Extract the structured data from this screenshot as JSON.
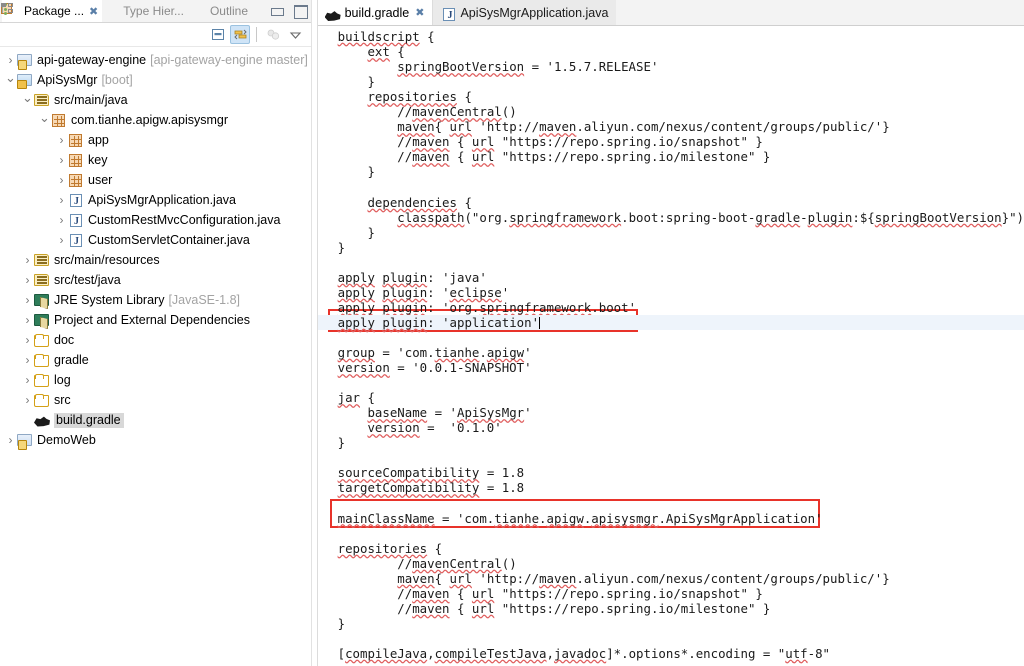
{
  "left_panel": {
    "view_tabs": [
      {
        "label": "Package ...",
        "icon": "package-explorer-icon",
        "active": true,
        "closable": true
      },
      {
        "label": "Type Hier...",
        "icon": "type-hierarchy-icon",
        "active": false,
        "closable": false
      },
      {
        "label": "Outline",
        "icon": "outline-icon",
        "active": false,
        "closable": false
      }
    ],
    "window_buttons": [
      {
        "name": "minimize-button",
        "icon": "minimize-icon"
      },
      {
        "name": "maximize-button",
        "icon": "maximize-icon"
      }
    ],
    "toolbar": [
      {
        "name": "collapse-all-button",
        "icon": "collapse-all-icon",
        "toggled": false
      },
      {
        "name": "link-with-editor-button",
        "icon": "link-with-editor-icon",
        "toggled": true
      },
      {
        "name": "focus-on-active-task-button",
        "icon": "focus-active-task-icon",
        "toggled": false,
        "disabled": true
      },
      {
        "name": "view-menu-button",
        "icon": "chevron-down-icon",
        "toggled": false
      }
    ],
    "tree": [
      {
        "indent": 0,
        "arrow": "collapsed",
        "icon": "project-icon",
        "label": "api-gateway-engine",
        "sub": "[api-gateway-engine master]",
        "selected": false
      },
      {
        "indent": 0,
        "arrow": "expanded",
        "icon": "project-boot-icon",
        "label": "ApiSysMgr",
        "sub": "[boot]",
        "selected": false
      },
      {
        "indent": 1,
        "arrow": "expanded",
        "icon": "source-folder-icon",
        "label": "src/main/java",
        "sub": "",
        "selected": false
      },
      {
        "indent": 2,
        "arrow": "expanded",
        "icon": "package-icon",
        "label": "com.tianhe.apigw.apisysmgr",
        "sub": "",
        "selected": false
      },
      {
        "indent": 3,
        "arrow": "collapsed",
        "icon": "package-icon",
        "label": "app",
        "sub": "",
        "selected": false
      },
      {
        "indent": 3,
        "arrow": "collapsed",
        "icon": "package-icon",
        "label": "key",
        "sub": "",
        "selected": false
      },
      {
        "indent": 3,
        "arrow": "collapsed",
        "icon": "package-icon",
        "label": "user",
        "sub": "",
        "selected": false
      },
      {
        "indent": 3,
        "arrow": "collapsed",
        "icon": "java-file-icon",
        "label": "ApiSysMgrApplication.java",
        "sub": "",
        "selected": false
      },
      {
        "indent": 3,
        "arrow": "collapsed",
        "icon": "java-file-icon",
        "label": "CustomRestMvcConfiguration.java",
        "sub": "",
        "selected": false
      },
      {
        "indent": 3,
        "arrow": "collapsed",
        "icon": "java-file-icon",
        "label": "CustomServletContainer.java",
        "sub": "",
        "selected": false
      },
      {
        "indent": 1,
        "arrow": "collapsed",
        "icon": "source-folder-icon",
        "label": "src/main/resources",
        "sub": "",
        "selected": false
      },
      {
        "indent": 1,
        "arrow": "collapsed",
        "icon": "source-folder-icon",
        "label": "src/test/java",
        "sub": "",
        "selected": false
      },
      {
        "indent": 1,
        "arrow": "collapsed",
        "icon": "library-icon",
        "label": "JRE System Library",
        "sub": "[JavaSE-1.8]",
        "selected": false
      },
      {
        "indent": 1,
        "arrow": "collapsed",
        "icon": "library-icon",
        "label": "Project and External Dependencies",
        "sub": "",
        "selected": false
      },
      {
        "indent": 1,
        "arrow": "collapsed",
        "icon": "folder-icon",
        "label": "doc",
        "sub": "",
        "selected": false
      },
      {
        "indent": 1,
        "arrow": "collapsed",
        "icon": "folder-icon",
        "label": "gradle",
        "sub": "",
        "selected": false
      },
      {
        "indent": 1,
        "arrow": "collapsed",
        "icon": "folder-icon",
        "label": "log",
        "sub": "",
        "selected": false
      },
      {
        "indent": 1,
        "arrow": "collapsed",
        "icon": "folder-icon",
        "label": "src",
        "sub": "",
        "selected": false
      },
      {
        "indent": 1,
        "arrow": "none",
        "icon": "gradle-file-icon",
        "label": "build.gradle",
        "sub": "",
        "selected": true
      },
      {
        "indent": 0,
        "arrow": "collapsed",
        "icon": "project-icon",
        "label": "DemoWeb",
        "sub": "",
        "selected": false
      }
    ]
  },
  "editor": {
    "tabs": [
      {
        "label": "build.gradle",
        "icon": "gradle-file-icon",
        "active": true,
        "closable": true
      },
      {
        "label": "ApiSysMgrApplication.java",
        "icon": "java-file-icon",
        "active": false,
        "closable": false
      }
    ],
    "highlight_boxes": [
      {
        "name": "apply-plugin-application-highlight",
        "color": "#e8332a"
      },
      {
        "name": "main-class-name-highlight",
        "color": "#e8332a"
      }
    ],
    "current_line_color": "#eef4fb",
    "code_lines": [
      "buildscript {",
      "    ext {",
      "        springBootVersion = '1.5.7.RELEASE'",
      "    }",
      "    repositories {",
      "        //mavenCentral()",
      "        maven{ url 'http://maven.aliyun.com/nexus/content/groups/public/'}",
      "        //maven { url \"https://repo.spring.io/snapshot\" }",
      "        //maven { url \"https://repo.spring.io/milestone\" }",
      "    }",
      "",
      "    dependencies {",
      "        classpath(\"org.springframework.boot:spring-boot-gradle-plugin:${springBootVersion}\")",
      "    }",
      "}",
      "",
      "apply plugin: 'java'",
      "apply plugin: 'eclipse'",
      "apply plugin: 'org.springframework.boot'",
      "apply plugin: 'application'",
      "",
      "group = 'com.tianhe.apigw'",
      "version = '0.0.1-SNAPSHOT'",
      "",
      "jar {",
      "    baseName = 'ApiSysMgr'",
      "    version =  '0.1.0'",
      "}",
      "",
      "sourceCompatibility = 1.8",
      "targetCompatibility = 1.8",
      "",
      "mainClassName = 'com.tianhe.apigw.apisysmgr.ApiSysMgrApplication'",
      "",
      "repositories {",
      "        //mavenCentral()",
      "        maven{ url 'http://maven.aliyun.com/nexus/content/groups/public/'}",
      "        //maven { url \"https://repo.spring.io/snapshot\" }",
      "        //maven { url \"https://repo.spring.io/milestone\" }",
      "}",
      "",
      "[compileJava,compileTestJava,javadoc]*.options*.encoding = \"utf-8\""
    ],
    "cursor_line_index": 19
  }
}
